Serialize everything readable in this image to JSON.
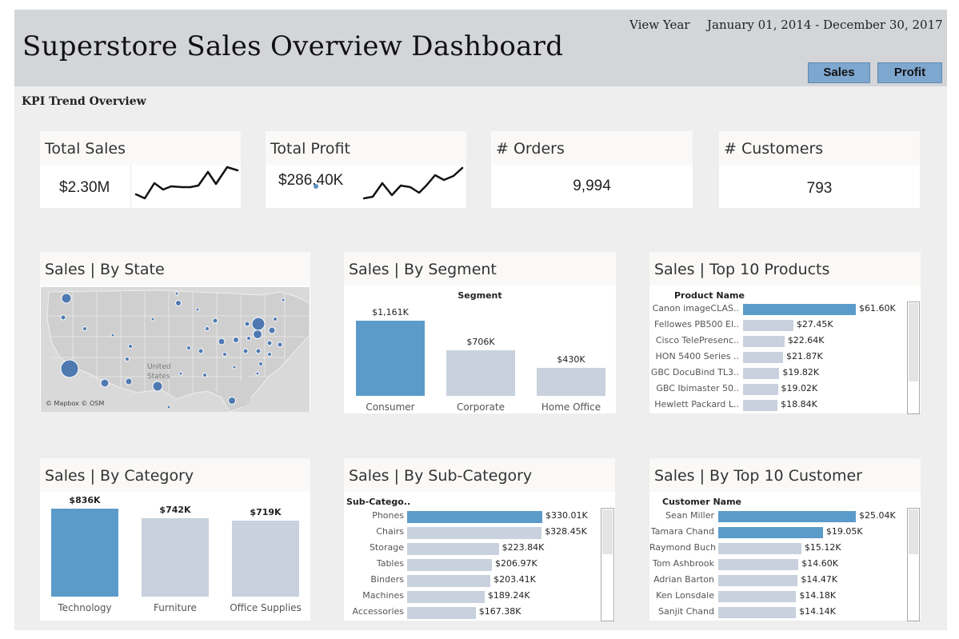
{
  "header": {
    "title": "Superstore Sales Overview Dashboard",
    "view_year_label": "View Year",
    "date_range": "January 01, 2014 - December 30, 2017",
    "buttons": {
      "sales": "Sales",
      "profit": "Profit"
    }
  },
  "kpi_section_title": "KPI Trend Overview",
  "kpis": {
    "total_sales": {
      "title": "Total Sales",
      "value": "$2.30M"
    },
    "total_profit": {
      "title": "Total Profit",
      "value": "$286.40K"
    },
    "orders": {
      "title": "# Orders",
      "value": "9,994"
    },
    "customers": {
      "title": "# Customers",
      "value": "793"
    }
  },
  "panels": {
    "state": {
      "title": "Sales | By State",
      "map_labels": [
        "United",
        "States"
      ],
      "attribution": "© Mapbox © OSM"
    },
    "segment": {
      "title": "Sales | By Segment",
      "header": "Segment"
    },
    "top_products": {
      "title": "Sales | Top 10 Products",
      "header": "Product Name"
    },
    "category": {
      "title": "Sales | By Category"
    },
    "subcategory": {
      "title": "Sales | By Sub-Category",
      "header": "Sub-Catego.."
    },
    "top_customers": {
      "title": "Sales | By Top 10 Customer",
      "header": "Customer Name"
    }
  },
  "chart_data": [
    {
      "type": "bar",
      "name": "segment",
      "categories": [
        "Consumer",
        "Corporate",
        "Home Office"
      ],
      "values": [
        1161,
        706,
        430
      ],
      "labels": [
        "$1,161K",
        "$706K",
        "$430K"
      ],
      "highlight": [
        true,
        false,
        false
      ]
    },
    {
      "type": "bar",
      "name": "top_products",
      "categories": [
        "Canon imageCLAS..",
        "Fellowes PB500 El..",
        "Cisco TelePresenc..",
        "HON 5400 Series ..",
        "GBC DocuBind TL3..",
        "GBC Ibimaster 50..",
        "Hewlett Packard L.."
      ],
      "values": [
        61.6,
        27.45,
        22.64,
        21.87,
        19.82,
        19.02,
        18.84
      ],
      "labels": [
        "$61.60K",
        "$27.45K",
        "$22.64K",
        "$21.87K",
        "$19.82K",
        "$19.02K",
        "$18.84K"
      ],
      "highlight": [
        true,
        false,
        false,
        false,
        false,
        false,
        false
      ]
    },
    {
      "type": "bar",
      "name": "category",
      "categories": [
        "Technology",
        "Furniture",
        "Office Supplies"
      ],
      "values": [
        836,
        742,
        719
      ],
      "labels": [
        "$836K",
        "$742K",
        "$719K"
      ],
      "highlight": [
        true,
        false,
        false
      ]
    },
    {
      "type": "bar",
      "name": "subcategory",
      "categories": [
        "Phones",
        "Chairs",
        "Storage",
        "Tables",
        "Binders",
        "Machines",
        "Accessories"
      ],
      "values": [
        330.01,
        328.45,
        223.84,
        206.97,
        203.41,
        189.24,
        167.38
      ],
      "labels": [
        "$330.01K",
        "$328.45K",
        "$223.84K",
        "$206.97K",
        "$203.41K",
        "$189.24K",
        "$167.38K"
      ],
      "highlight": [
        true,
        false,
        false,
        false,
        false,
        false,
        false
      ]
    },
    {
      "type": "bar",
      "name": "top_customers",
      "categories": [
        "Sean Miller",
        "Tamara Chand",
        "Raymond Buch",
        "Tom Ashbrook",
        "Adrian Barton",
        "Ken Lonsdale",
        "Sanjit Chand"
      ],
      "values": [
        25.04,
        19.05,
        15.12,
        14.6,
        14.47,
        14.18,
        14.14
      ],
      "labels": [
        "$25.04K",
        "$19.05K",
        "$15.12K",
        "$14.60K",
        "$14.47K",
        "$14.18K",
        "$14.14K"
      ],
      "highlight": [
        true,
        true,
        false,
        false,
        false,
        false,
        false
      ]
    }
  ],
  "colors": {
    "highlight": "#5b9bc9",
    "base": "#c8d1dd",
    "header_bg": "#d3d5d9",
    "button": "#7ea7cf"
  }
}
